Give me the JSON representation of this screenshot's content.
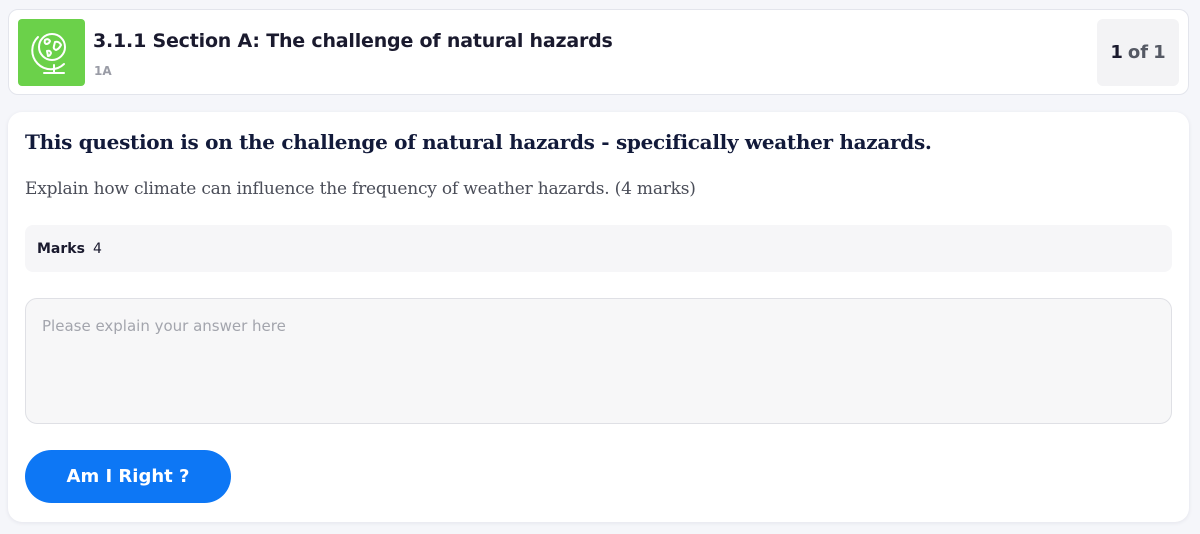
{
  "header": {
    "title": "3.1.1 Section A: The challenge of natural hazards",
    "subtitle": "1A",
    "icon": "globe-icon",
    "icon_bg_color": "#6bd14a",
    "counter": {
      "current": "1",
      "separator": "of",
      "total": "1"
    }
  },
  "question": {
    "heading": "This question is on the challenge of natural hazards - specifically weather hazards.",
    "text": "Explain how climate can influence the frequency of weather hazards. (4 marks)",
    "marks_label": "Marks",
    "marks_value": "4"
  },
  "answer": {
    "placeholder": "Please explain your answer here",
    "value": ""
  },
  "submit": {
    "label": "Am I Right ?",
    "color": "#0d77f5"
  }
}
